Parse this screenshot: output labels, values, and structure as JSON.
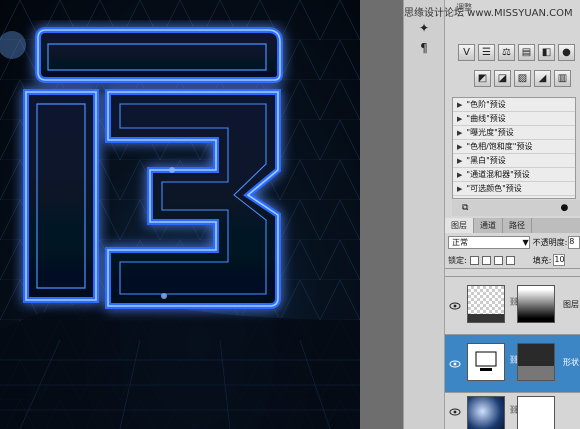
{
  "watermark": "思缘设计论坛 www.MISSYUAN.COM",
  "panel_title": "调整",
  "tool_icons": [
    "sparkle-icon",
    "paragraph-icon"
  ],
  "adjustment_icons_row1": [
    "levels-icon",
    "brightness-icon",
    "curves-icon",
    "exposure-icon",
    "vibrance-icon",
    "hue-icon"
  ],
  "adjustment_icons_row2": [
    "color-balance-icon",
    "black-white-icon",
    "photo-filter-icon",
    "channel-mixer-icon",
    "invert-icon"
  ],
  "presets": [
    {
      "label": "\"色阶\"预设"
    },
    {
      "label": "\"曲线\"预设"
    },
    {
      "label": "\"曝光度\"预设"
    },
    {
      "label": "\"色相/饱和度\"预设"
    },
    {
      "label": "\"黑白\"预设"
    },
    {
      "label": "\"通道混和器\"预设"
    },
    {
      "label": "\"可选颜色\"预设"
    }
  ],
  "layers_panel": {
    "tabs": [
      "图层",
      "通道",
      "路径"
    ],
    "active_tab": "图层",
    "blend_mode": "正常",
    "opacity_label": "不透明度:",
    "opacity_value": "8",
    "lock_label": "锁定:",
    "fill_label": "填充:",
    "fill_value": "10",
    "layers": [
      {
        "name": "图层",
        "selected": false
      },
      {
        "name": "形状",
        "selected": true
      },
      {
        "name": "",
        "selected": false
      }
    ]
  },
  "colors": {
    "glow": "#2f6bff",
    "glow_core": "#9fd0ff",
    "selection": "#3d86c6"
  }
}
